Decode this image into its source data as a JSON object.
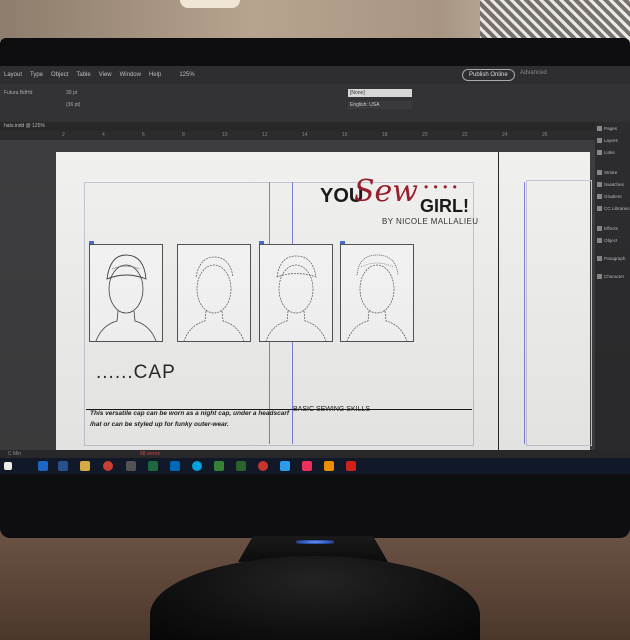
{
  "app": {
    "menu": [
      "Layout",
      "Type",
      "Object",
      "Table",
      "View",
      "Window",
      "Help"
    ],
    "zoom": "125%",
    "publish_label": "Publish Online",
    "workspace_label": "Advanced",
    "font_name": "Futura BdHd",
    "font_size": "30 pt",
    "font_leading": "(36 pt)",
    "style_field": "[None]",
    "language_field": "English: USA",
    "tab_label": "hats.indd @ 125%",
    "status_left": "C Min",
    "status_errors": "88 errors"
  },
  "ruler": [
    "2",
    "4",
    "6",
    "8",
    "10",
    "12",
    "14",
    "16",
    "18",
    "20",
    "22",
    "24",
    "26"
  ],
  "panels": [
    "Pages",
    "Layers",
    "Links",
    "Stroke",
    "Swatches",
    "Gradient",
    "CC Libraries",
    "Effects",
    "Object",
    "Paragraph",
    "Character"
  ],
  "document": {
    "logo": {
      "you": "YOU",
      "sew": "Sew",
      "girl": "GIRL!",
      "byline": "BY NICOLE MALLALIEU"
    },
    "cap_title": "......CAP",
    "description": "This versatile cap can be worn as a night cap, under a headscarf /hat or can be styled up for funky outer-wear.",
    "skills": "BASIC SEWING SKILLS"
  },
  "taskbar": [
    {
      "icon": "edge-icon",
      "color": "#1f6fd6"
    },
    {
      "icon": "word-icon",
      "color": "#2b5797"
    },
    {
      "icon": "file-explorer-icon",
      "color": "#e8b84a"
    },
    {
      "icon": "chrome-icon",
      "color": "#db4437"
    },
    {
      "icon": "store-icon",
      "color": "#5a5a5a"
    },
    {
      "icon": "excel-icon",
      "color": "#1e7145"
    },
    {
      "icon": "outlook-icon",
      "color": "#0072c6"
    },
    {
      "icon": "skype-icon",
      "color": "#00aff0"
    },
    {
      "icon": "app-icon",
      "color": "#3c8c3c"
    },
    {
      "icon": "app-icon-2",
      "color": "#2f6b2f"
    },
    {
      "icon": "app-icon-3",
      "color": "#d63a2f"
    },
    {
      "icon": "photoshop-icon",
      "color": "#31a8ff"
    },
    {
      "icon": "indesign-icon",
      "color": "#ff3366"
    },
    {
      "icon": "illustrator-icon",
      "color": "#ff9a00"
    },
    {
      "icon": "acrobat-icon",
      "color": "#e2231a"
    }
  ]
}
